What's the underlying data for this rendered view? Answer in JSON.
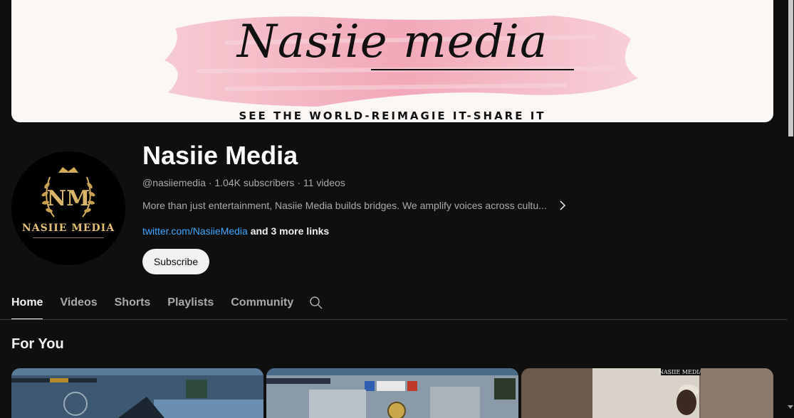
{
  "banner": {
    "title": "Nasiie media",
    "tagline": "SEE THE WORLD-REIMAGIE IT-SHARE IT"
  },
  "avatar": {
    "logo_text": "NASIIE MEDIA",
    "monogram": "NM"
  },
  "channel": {
    "name": "Nasiie Media",
    "handle": "@nasiiemedia",
    "subscribers": "1.04K subscribers",
    "videos": "11 videos",
    "separator": "·",
    "description": "More than just entertainment, Nasiie Media builds bridges. We amplify voices across cultu...",
    "link": "twitter.com/NasiieMedia",
    "more_links": "and 3 more links",
    "subscribe_label": "Subscribe"
  },
  "tabs": [
    {
      "label": "Home",
      "active": true
    },
    {
      "label": "Videos",
      "active": false
    },
    {
      "label": "Shorts",
      "active": false
    },
    {
      "label": "Playlists",
      "active": false
    },
    {
      "label": "Community",
      "active": false
    }
  ],
  "section": {
    "title": "For You"
  },
  "thumbnails": [
    {
      "kind": "game-screenshot"
    },
    {
      "kind": "game-screenshot"
    },
    {
      "kind": "video-still",
      "overlay_text": "NASIIE MEDIA"
    }
  ],
  "colors": {
    "background": "#0f0f0f",
    "link": "#3ea6ff",
    "banner_brush": "#f3a6b5",
    "gold": "#e2c077"
  },
  "icons": {
    "search": "search-icon",
    "chevron": "chevron-right-icon"
  }
}
